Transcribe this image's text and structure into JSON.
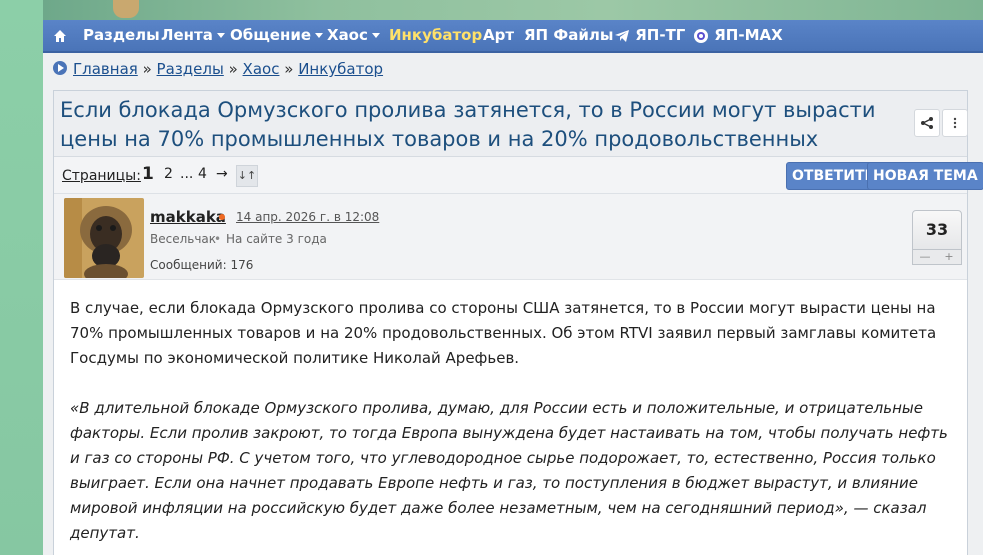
{
  "nav": {
    "items": [
      {
        "label": "Разделы",
        "caret": false
      },
      {
        "label": "Лента",
        "caret": true
      },
      {
        "label": "Общение",
        "caret": true
      },
      {
        "label": "Хаос",
        "caret": true
      },
      {
        "label": "Инкубатор",
        "caret": false,
        "highlight": true
      },
      {
        "label": "Арт",
        "caret": false
      },
      {
        "label": "ЯП Файлы",
        "caret": false
      },
      {
        "label": "ЯП-ТГ",
        "caret": false
      },
      {
        "label": "ЯП-MAX",
        "caret": false
      }
    ]
  },
  "breadcrumb": {
    "items": [
      "Главная",
      "Разделы",
      "Хаос",
      "Инкубатор"
    ],
    "separator": "»"
  },
  "thread": {
    "title": "Если блокада Ормузского пролива затянется, то в России могут вырасти цены на 70% промышленных товаров и на 20% продовольственных"
  },
  "pager": {
    "label": "Страницы:",
    "pages": [
      "1",
      "2",
      "...",
      "4",
      "→"
    ],
    "sort_icon": "↓↑",
    "reply_label": "ОТВЕТИТЬ",
    "new_topic_label": "НОВАЯ ТЕМА"
  },
  "post": {
    "username": "makkaka",
    "date": "14 апр. 2026 г. в 12:08",
    "user_title": "Весельчак",
    "user_status": "На сайте 3 года",
    "messages": "Сообщений: 176",
    "rating": "33",
    "rating_minus": "—",
    "rating_plus": "+",
    "paragraphs": [
      "В случае, если блокада Ормузского пролива со стороны США затянется, то в России могут вырасти цены на 70% промышленных товаров и на 20% продовольственных. Об этом RTVI заявил первый замглавы комитета Госдумы по экономической политике Николай Арефьев.",
      "«В длительной блокаде Ормузского пролива, думаю, для России есть и положительные, и отрицательные факторы. Если пролив закроют, то тогда Европа вынуждена будет настаивать на том, чтобы получать нефть и газ со стороны РФ. С учетом того, что углеводородное сырье подорожает, то, естественно, Россия только выиграет. Если она начнет продавать Европе нефть и газ, то поступления в бюджет вырастут, и влияние мировой инфляции на российскую будет даже более незаметным, чем на сегодняшний период», — сказал депутат."
    ]
  },
  "colors": {
    "nav_bg": "#4a74b8",
    "nav_highlight": "#ffe169",
    "title_color": "#1d4f7d",
    "online_dot": "#f06a22"
  }
}
